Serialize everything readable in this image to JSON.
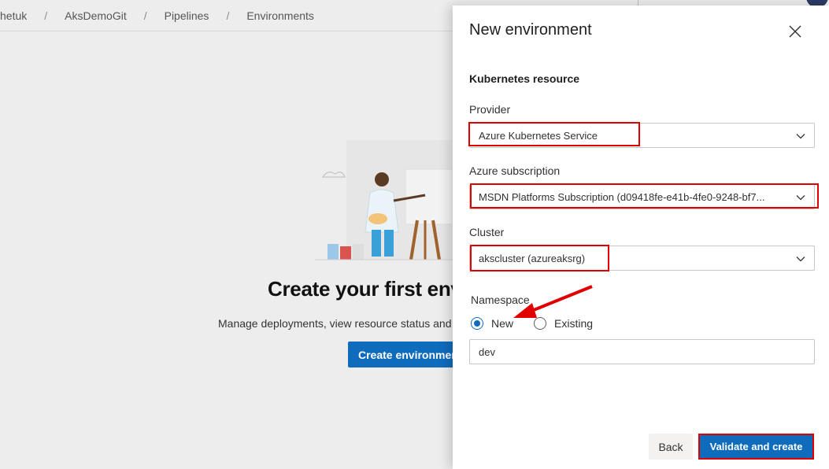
{
  "breadcrumb": {
    "items": [
      "hetuk",
      "AksDemoGit",
      "Pipelines",
      "Environments"
    ],
    "separator": "/"
  },
  "empty_state": {
    "title": "Create your first env",
    "subtitle": "Manage deployments, view resource status and c",
    "button_label": "Create environment"
  },
  "panel": {
    "title": "New environment",
    "close_icon": "close-icon",
    "section_title": "Kubernetes resource",
    "provider": {
      "label": "Provider",
      "value": "Azure Kubernetes Service"
    },
    "subscription": {
      "label": "Azure subscription",
      "value": "MSDN Platforms Subscription (d09418fe-e41b-4fe0-9248-bf7..."
    },
    "cluster": {
      "label": "Cluster",
      "value": "akscluster (azureaksrg)"
    },
    "namespace": {
      "label": "Namespace",
      "options": [
        "New",
        "Existing"
      ],
      "selected": "New",
      "value": "dev"
    },
    "back_label": "Back",
    "validate_label": "Validate and create"
  },
  "colors": {
    "accent": "#0f6cbd",
    "highlight": "#e00000"
  }
}
